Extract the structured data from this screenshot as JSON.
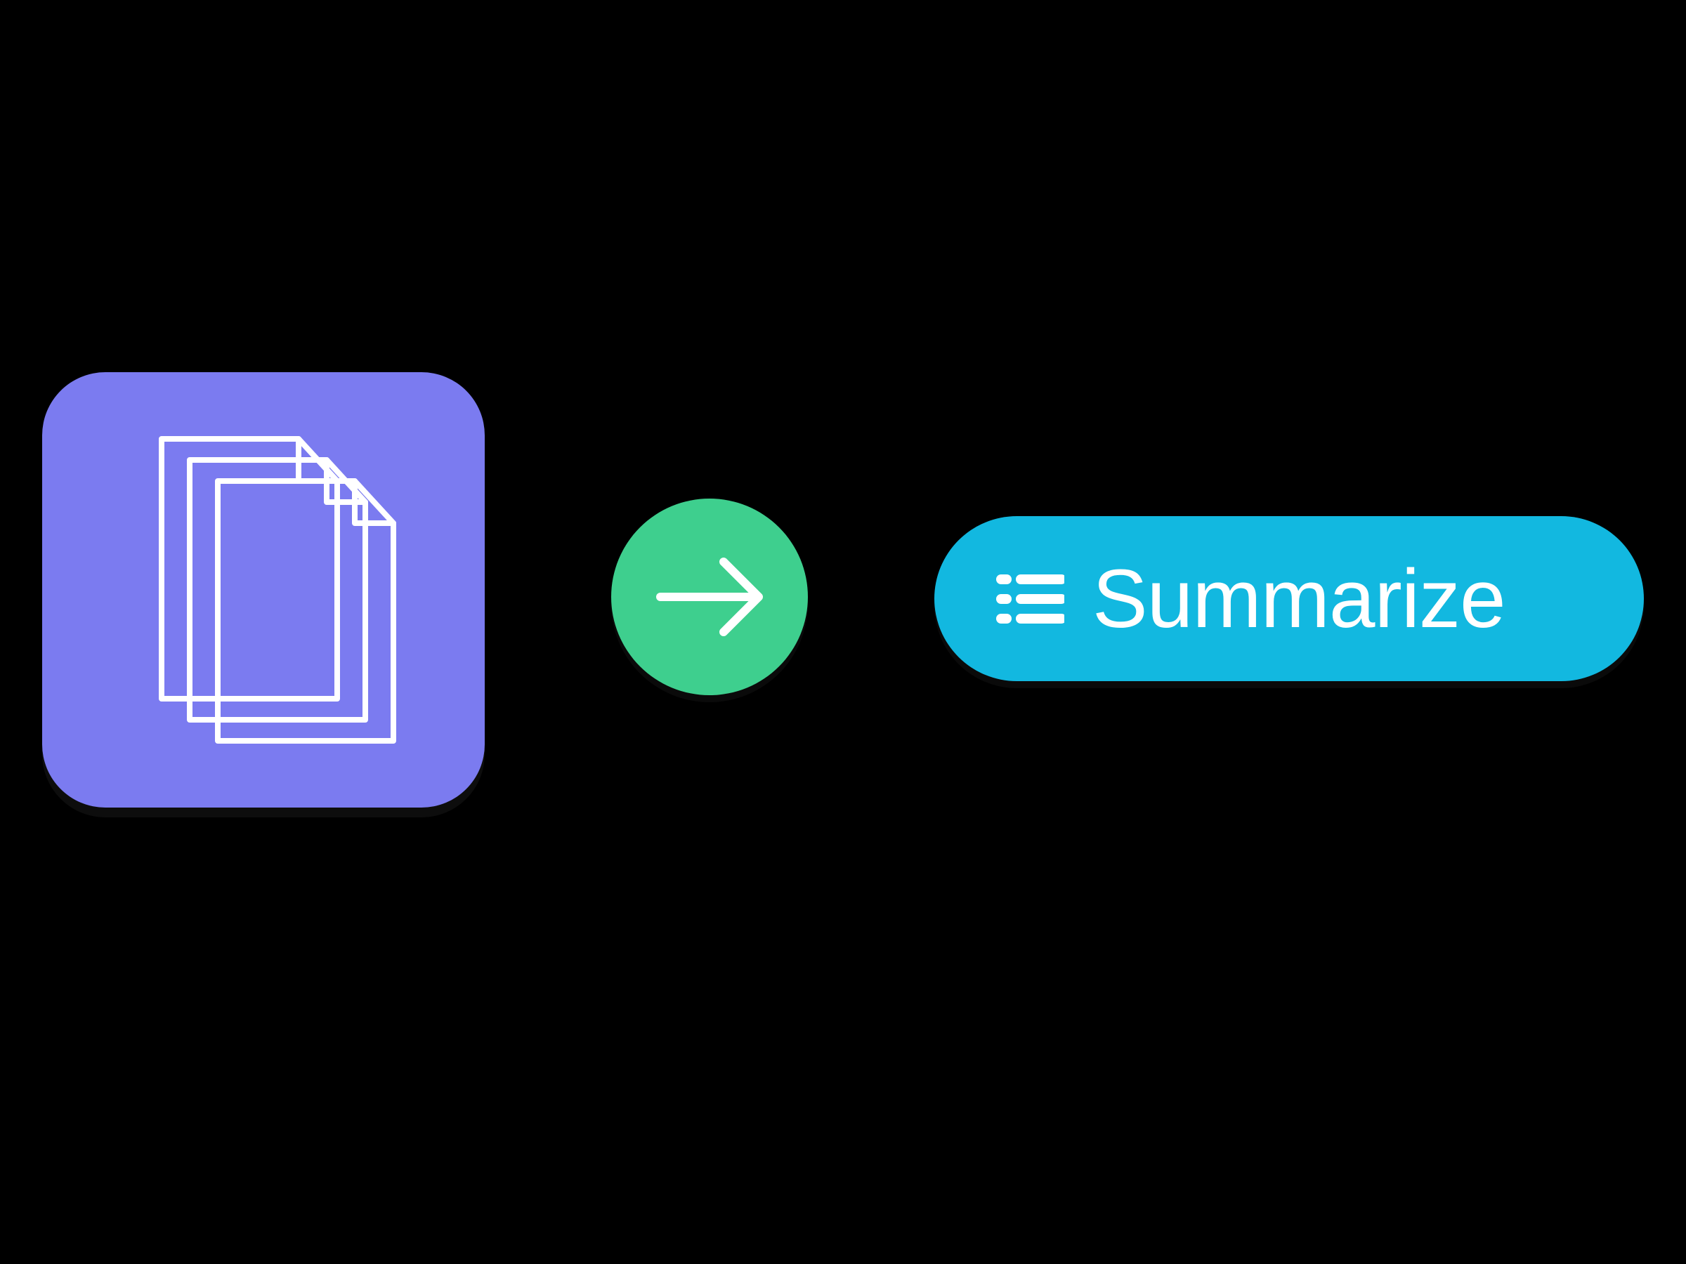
{
  "flow": {
    "documents_icon": "documents-stack",
    "arrow_icon": "arrow-right",
    "summarize_icon": "bullet-list",
    "summarize_label": "Summarize"
  },
  "colors": {
    "background": "#000000",
    "doc_tile": "#7B7BF0",
    "arrow_circle": "#3ECF8E",
    "pill": "#12B8E0",
    "pill_text": "#FFFFFF",
    "icon_stroke": "#FFFFFF"
  }
}
